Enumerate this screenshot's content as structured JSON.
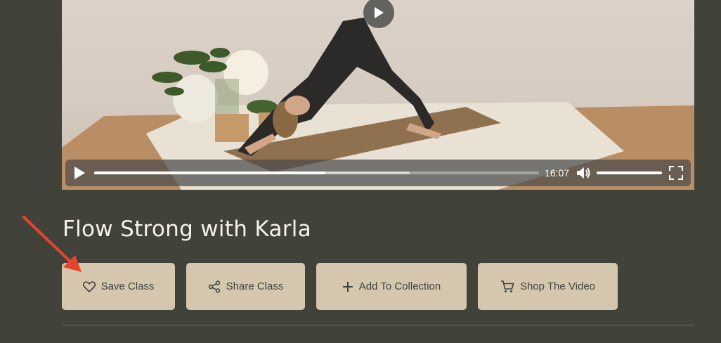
{
  "video": {
    "current_time": "16:07",
    "progress_fraction": 0.52,
    "buffered_fraction": 0.71,
    "volume_fraction": 1.0
  },
  "class": {
    "title": "Flow Strong with Karla"
  },
  "actions": {
    "save_label": "Save Class",
    "share_label": "Share Class",
    "collection_label": "Add To Collection",
    "shop_label": "Shop The Video"
  },
  "icons": {
    "big_play": "play-icon",
    "play": "play-icon",
    "volume": "volume-icon",
    "fullscreen": "fullscreen-icon",
    "save": "heart-icon",
    "share": "share-icon",
    "collection": "plus-icon",
    "shop": "cart-icon"
  },
  "colors": {
    "background": "#41423a",
    "button": "#d4c7ae",
    "button_text": "#43443c",
    "title": "#f5f1ea",
    "annotation_arrow": "#e8432e"
  }
}
